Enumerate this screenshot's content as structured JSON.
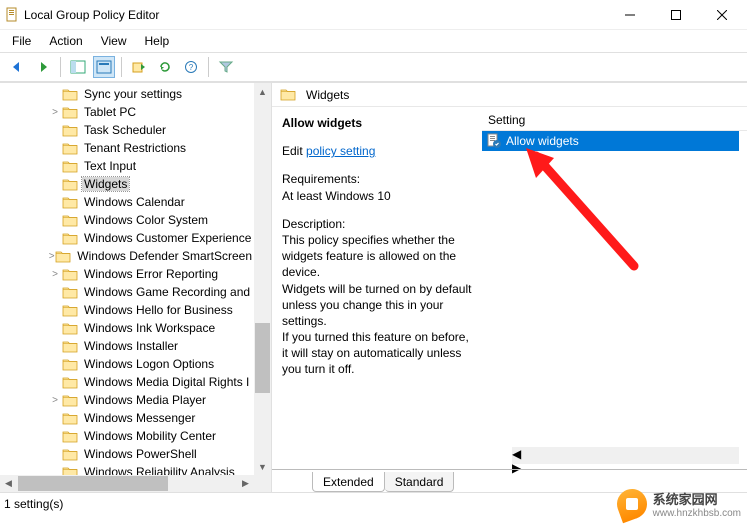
{
  "window": {
    "title": "Local Group Policy Editor"
  },
  "menu": {
    "file": "File",
    "action": "Action",
    "view": "View",
    "help": "Help"
  },
  "tree": {
    "items": [
      {
        "label": "Sync your settings",
        "depth": 3,
        "expand": ""
      },
      {
        "label": "Tablet PC",
        "depth": 3,
        "expand": ">"
      },
      {
        "label": "Task Scheduler",
        "depth": 3,
        "expand": ""
      },
      {
        "label": "Tenant Restrictions",
        "depth": 3,
        "expand": ""
      },
      {
        "label": "Text Input",
        "depth": 3,
        "expand": ""
      },
      {
        "label": "Widgets",
        "depth": 3,
        "expand": "",
        "selected": true
      },
      {
        "label": "Windows Calendar",
        "depth": 3,
        "expand": ""
      },
      {
        "label": "Windows Color System",
        "depth": 3,
        "expand": ""
      },
      {
        "label": "Windows Customer Experience",
        "depth": 3,
        "expand": ""
      },
      {
        "label": "Windows Defender SmartScreen",
        "depth": 3,
        "expand": ">"
      },
      {
        "label": "Windows Error Reporting",
        "depth": 3,
        "expand": ">"
      },
      {
        "label": "Windows Game Recording and",
        "depth": 3,
        "expand": ""
      },
      {
        "label": "Windows Hello for Business",
        "depth": 3,
        "expand": ""
      },
      {
        "label": "Windows Ink Workspace",
        "depth": 3,
        "expand": ""
      },
      {
        "label": "Windows Installer",
        "depth": 3,
        "expand": ""
      },
      {
        "label": "Windows Logon Options",
        "depth": 3,
        "expand": ""
      },
      {
        "label": "Windows Media Digital Rights I",
        "depth": 3,
        "expand": ""
      },
      {
        "label": "Windows Media Player",
        "depth": 3,
        "expand": ">"
      },
      {
        "label": "Windows Messenger",
        "depth": 3,
        "expand": ""
      },
      {
        "label": "Windows Mobility Center",
        "depth": 3,
        "expand": ""
      },
      {
        "label": "Windows PowerShell",
        "depth": 3,
        "expand": ""
      },
      {
        "label": "Windows Reliability Analysis",
        "depth": 3,
        "expand": ""
      }
    ]
  },
  "header": {
    "category": "Widgets"
  },
  "description": {
    "title": "Allow widgets",
    "edit_prefix": "Edit ",
    "edit_link": "policy setting ",
    "req_label": "Requirements:",
    "req_text": "At least Windows 10",
    "desc_label": "Description:",
    "desc_text": "This policy specifies whether the widgets feature is allowed on the device.\nWidgets will be turned on by default unless you change this in your settings.\nIf you turned this feature on before, it will stay on automatically unless you turn it off."
  },
  "settings": {
    "column": "Setting",
    "items": [
      {
        "label": "Allow widgets"
      }
    ]
  },
  "tabs": {
    "extended": "Extended",
    "standard": "Standard"
  },
  "status": {
    "text": "1 setting(s)"
  },
  "watermark": {
    "name": "系统家园网",
    "url": "www.hnzkhbsb.com"
  }
}
